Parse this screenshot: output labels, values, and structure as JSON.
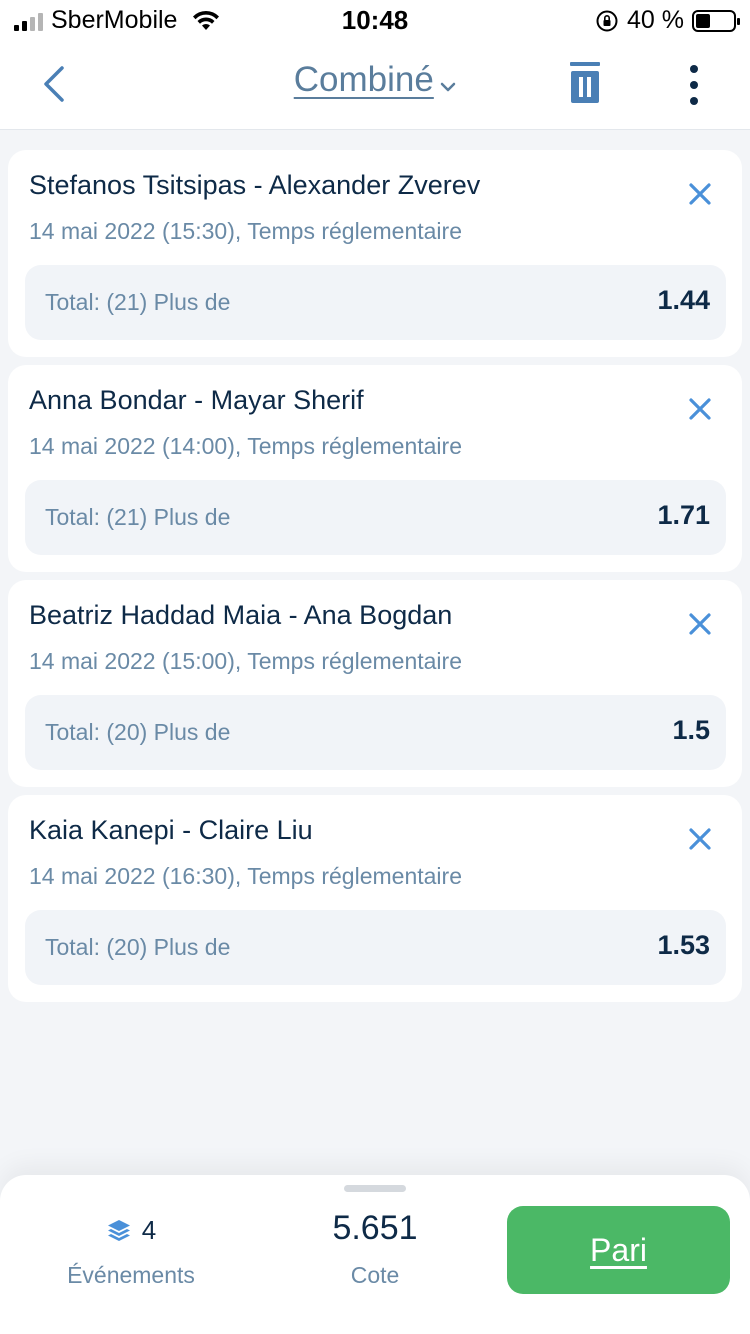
{
  "status_bar": {
    "carrier": "SberMobile",
    "time": "10:48",
    "battery": "40 %"
  },
  "header": {
    "title": "Combiné",
    "icons": [
      "back-chevron-icon",
      "chevron-down-icon",
      "trash-icon",
      "more-vertical-icon"
    ]
  },
  "bets": [
    {
      "match": "Stefanos Tsitsipas - Alexander Zverev",
      "details": "14 mai 2022 (15:30), Temps réglementaire",
      "selection": "Total: (21) Plus de",
      "odds": "1.44"
    },
    {
      "match": "Anna Bondar - Mayar Sherif",
      "details": "14 mai 2022 (14:00), Temps réglementaire",
      "selection": "Total: (21) Plus de",
      "odds": "1.71"
    },
    {
      "match": "Beatriz Haddad Maia - Ana Bogdan",
      "details": "14 mai 2022 (15:00), Temps réglementaire",
      "selection": "Total: (20) Plus de",
      "odds": "1.5"
    },
    {
      "match": "Kaia Kanepi - Claire Liu",
      "details": "14 mai 2022 (16:30), Temps réglementaire",
      "selection": "Total: (20) Plus de",
      "odds": "1.53"
    }
  ],
  "summary": {
    "events_count": "4",
    "events_label": "Événements",
    "cote_value": "5.651",
    "cote_label": "Cote",
    "bet_button": "Pari"
  },
  "colors": {
    "accent": "#4a90d9",
    "title": "#5a7d9c",
    "text_dark": "#0e2a47",
    "text_muted": "#6a8aa6",
    "button_green": "#4bb866"
  }
}
